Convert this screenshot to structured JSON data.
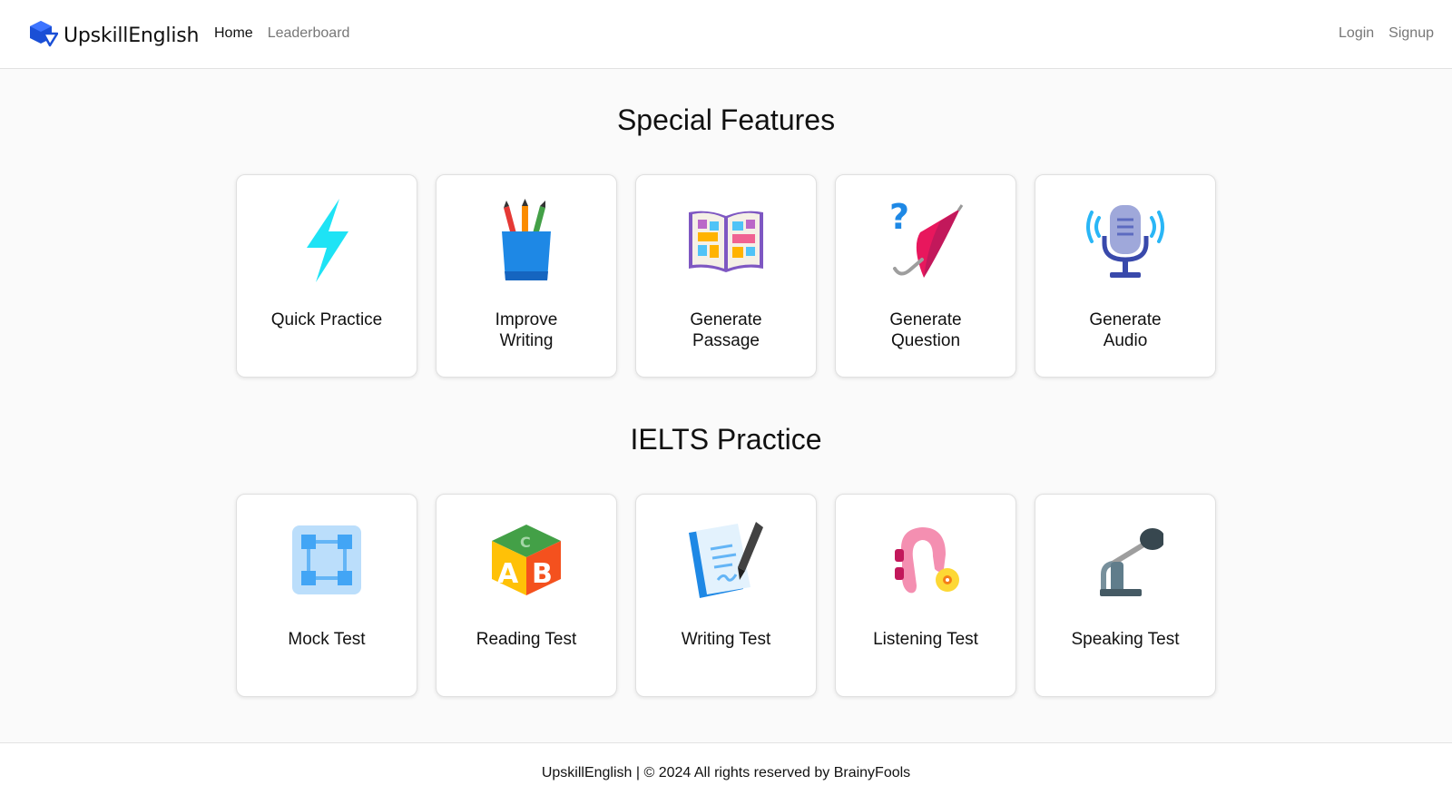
{
  "brand": {
    "name": "UpskillEnglish"
  },
  "nav": {
    "links": [
      {
        "label": "Home",
        "active": true
      },
      {
        "label": "Leaderboard",
        "active": false
      }
    ],
    "auth": {
      "login": "Login",
      "signup": "Signup"
    }
  },
  "special_features": {
    "title": "Special Features",
    "cards": [
      {
        "label": "Quick Practice",
        "icon": "lightning-icon"
      },
      {
        "label": "Improve Writing",
        "icon": "pencil-cup-icon"
      },
      {
        "label": "Generate Passage",
        "icon": "open-book-icon"
      },
      {
        "label": "Generate Question",
        "icon": "question-umbrella-icon"
      },
      {
        "label": "Generate Audio",
        "icon": "microphone-icon"
      }
    ]
  },
  "ielts_practice": {
    "title": "IELTS Practice",
    "cards": [
      {
        "label": "Mock Test",
        "icon": "grid-nodes-icon"
      },
      {
        "label": "Reading Test",
        "icon": "abc-block-icon"
      },
      {
        "label": "Writing Test",
        "icon": "notebook-pen-icon"
      },
      {
        "label": "Listening Test",
        "icon": "hearing-aid-icon"
      },
      {
        "label": "Speaking Test",
        "icon": "desk-microphone-icon"
      }
    ]
  },
  "footer": {
    "text": "UpskillEnglish | © 2024 All rights reserved by BrainyFools"
  },
  "colors": {
    "brand_blue": "#1a4fd6",
    "lightning": "#1ee3f5",
    "umbrella": "#e8175d"
  }
}
